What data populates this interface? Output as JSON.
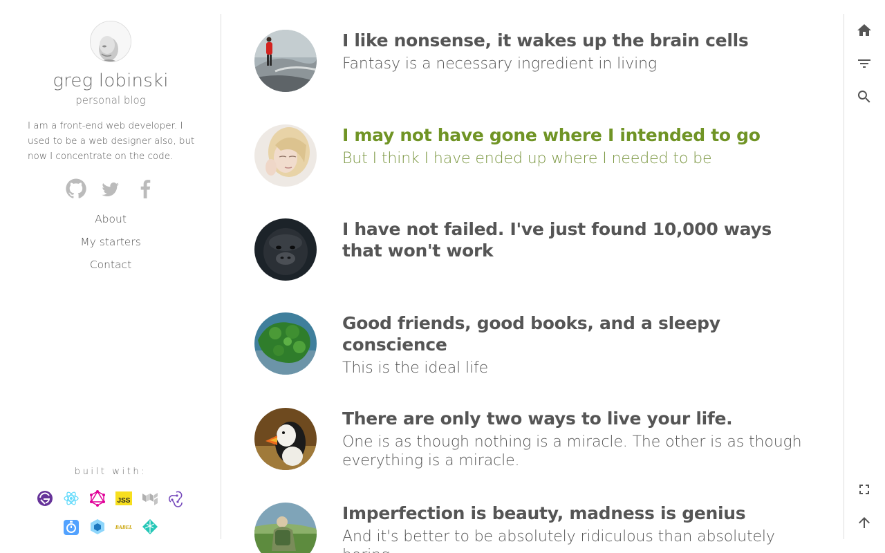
{
  "sidebar": {
    "author_name": "greg lobinski",
    "subtitle": "personal blog",
    "bio": "I am a front-end web developer. I used to be a web designer also, but now I concentrate on the code.",
    "social": [
      {
        "name": "github-icon"
      },
      {
        "name": "twitter-icon"
      },
      {
        "name": "facebook-icon"
      }
    ],
    "nav": [
      "About",
      "My starters",
      "Contact"
    ],
    "built_with_label": "built with:",
    "built_with_icons": [
      "gatsby-icon",
      "react-icon",
      "graphql-icon",
      "jss-icon",
      "material-ui-icon",
      "redux-icon",
      "lodash-icon",
      "webpack-icon",
      "babel-icon",
      "netlify-icon"
    ],
    "jss_text": "JSS",
    "babel_text": "BABEL"
  },
  "posts": [
    {
      "title": "I like nonsense, it wakes up the brain cells",
      "subtitle": "Fantasy is a necessary ingredient in living",
      "image": "person-on-rocks-photo",
      "active": false
    },
    {
      "title": "I may not have gone where I intended to go",
      "subtitle": "But I think I have ended up where I needed to be",
      "image": "blonde-girl-photo",
      "active": true
    },
    {
      "title": "I have not failed. I've just found 10,000 ways that won't work",
      "subtitle": "",
      "image": "gorilla-photo",
      "active": false
    },
    {
      "title": "Good friends, good books, and a sleepy conscience",
      "subtitle": "This is the ideal life",
      "image": "green-island-photo",
      "active": false
    },
    {
      "title": "There are only two ways to live your life.",
      "subtitle": "One is as though nothing is a miracle. The other is as though everything is a miracle.",
      "image": "puffin-photo",
      "active": false
    },
    {
      "title": "Imperfection is beauty, madness is genius",
      "subtitle": "And it's better to be absolutely ridiculous than absolutely boring",
      "image": "hiker-photo",
      "active": false
    }
  ],
  "actions": {
    "top": [
      "home-icon",
      "filter-icon",
      "search-icon"
    ],
    "bottom": [
      "fullscreen-icon",
      "arrow-up-icon"
    ]
  },
  "colors": {
    "text": "#555555",
    "active_post": "#709425",
    "divider": "#dddddd"
  }
}
